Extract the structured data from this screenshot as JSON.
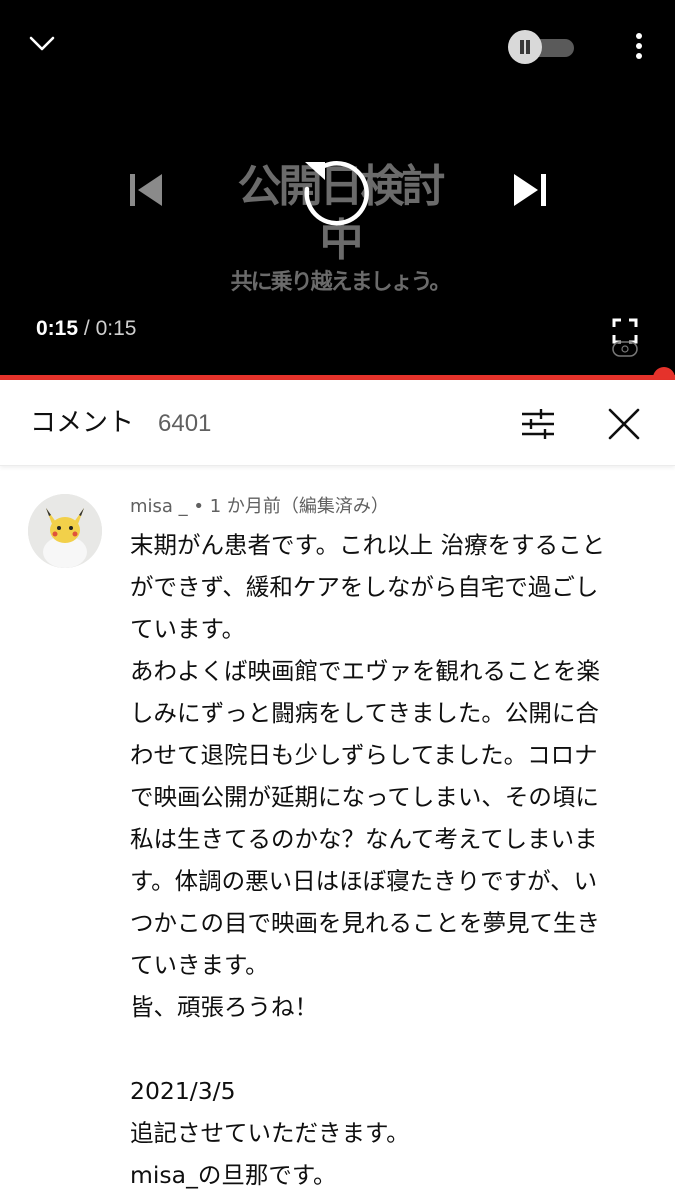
{
  "player": {
    "frame_text": {
      "line1": "公開日検討中",
      "line2": "共に乗り越えましょう。"
    },
    "time": {
      "current": "0:15",
      "separator": "/",
      "duration": "0:15"
    },
    "progress_fraction": 1.0,
    "icons": {
      "collapse": "chevron-down-icon",
      "autoplay": "autoplay-toggle-icon",
      "menu": "more-vert-icon",
      "previous": "skip-previous-icon",
      "replay": "replay-icon",
      "next": "skip-next-icon",
      "fullscreen": "fullscreen-icon"
    },
    "colors": {
      "background": "#000000",
      "progress": "#e5322b"
    }
  },
  "comments": {
    "title": "コメント",
    "count": "6401",
    "icons": {
      "sort": "sort-filter-icon",
      "close": "close-icon"
    }
  },
  "comment": {
    "author": "misa _",
    "meta_sep": " • ",
    "time": "1 か月前",
    "edited": "（編集済み）",
    "avatar_icon": "avatar-icon",
    "lines": [
      "末期がん患者です。これ以上 治療をすること",
      "ができず、緩和ケアをしながら自宅で過ごし",
      "ています。",
      "あわよくば映画館でエヴァを観れることを楽",
      "しみにずっと闘病をしてきました。公開に合",
      "わせて退院日も少しずらしてました。コロナ",
      "で映画公開が延期になってしまい、その頃に",
      "私は生きてるのかな？なんて考えてしまいま",
      "す。体調の悪い日はほぼ寝たきりですが、い",
      "つかこの目で映画を見れることを夢見て生き",
      "ていきます。",
      "皆、頑張ろうね！"
    ],
    "lines_after_blank": [
      "2021/3/5",
      "追記させていただきます。",
      "misa_の旦那です。"
    ]
  }
}
